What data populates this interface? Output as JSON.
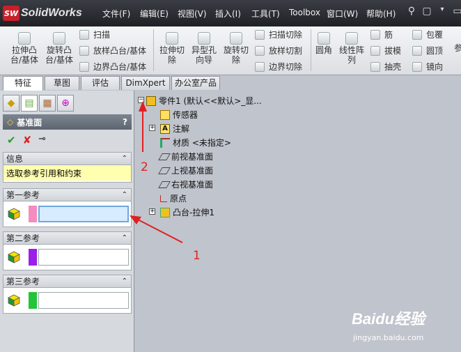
{
  "app": {
    "logo_badge": "SW",
    "name": "SolidWorks"
  },
  "menu": [
    "文件(F)",
    "编辑(E)",
    "视图(V)",
    "插入(I)",
    "工具(T)",
    "Toolbox",
    "窗口(W)",
    "帮助(H)"
  ],
  "toolbar": {
    "extrude_boss": [
      "拉伸凸",
      "台/基体"
    ],
    "revolve_boss": [
      "旋转凸",
      "台/基体"
    ],
    "sweep": "扫描",
    "loft": "放样凸台/基体",
    "boundary": "边界凸台/基体",
    "extrude_cut": [
      "拉伸切",
      "除"
    ],
    "hole_wizard": [
      "异型孔",
      "向导"
    ],
    "revolve_cut": [
      "旋转切",
      "除"
    ],
    "swept_cut": "扫描切除",
    "lofted_cut": "放样切割",
    "boundary_cut": "边界切除",
    "fillet": "圆角",
    "linear_pattern": [
      "线性阵",
      "列"
    ],
    "rib": "筋",
    "draft": "拔模",
    "shell": "抽壳",
    "wrap": "包覆",
    "dome": "圆顶",
    "mirror": "镜向",
    "more": "参"
  },
  "tabs": [
    "特征",
    "草图",
    "评估",
    "DimXpert",
    "办公室产品"
  ],
  "property_manager": {
    "title": "基准面",
    "help": "?",
    "info_header": "信息",
    "info_message": "选取参考引用和约束",
    "first_ref": "第一参考",
    "second_ref": "第二参考",
    "third_ref": "第三参考",
    "ref_colors": [
      "#f48cc0",
      "#9b1fe8",
      "#22c43a"
    ]
  },
  "tree": {
    "root": "零件1  (默认<<默认>_显...",
    "items": [
      "传感器",
      "注解",
      "材质 <未指定>",
      "前视基准面",
      "上视基准面",
      "右视基准面",
      "原点",
      "凸台-拉伸1"
    ]
  },
  "annotations": {
    "label1": "1",
    "label2": "2"
  },
  "watermark": {
    "brand": "Baidu经验",
    "url": "jingyan.baidu.com"
  }
}
